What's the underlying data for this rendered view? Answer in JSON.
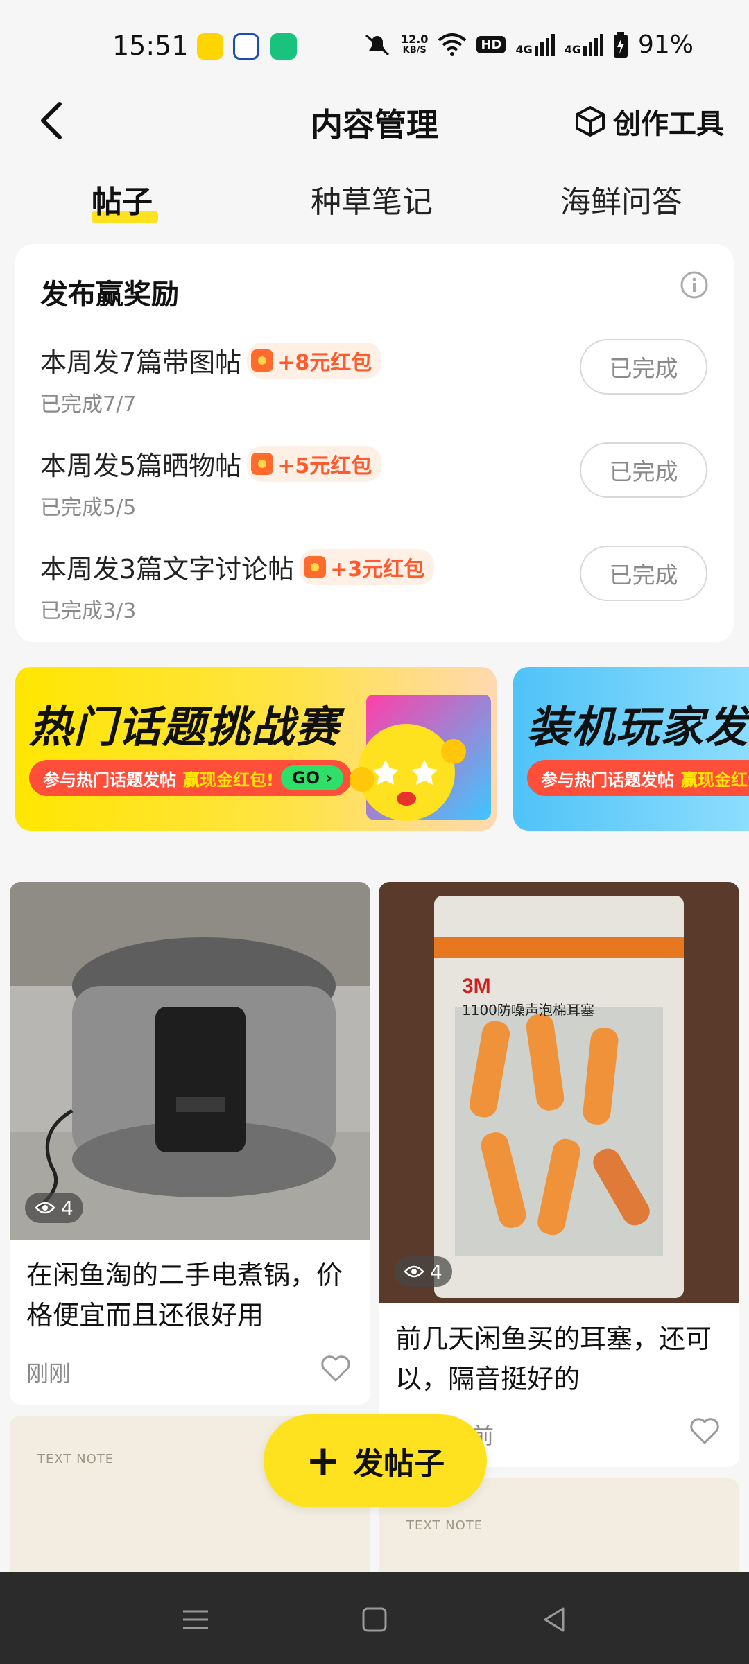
{
  "status_bar": {
    "time": "15:51",
    "net_speed_top": "12.0",
    "net_speed_unit": "KB/S",
    "hd_label": "HD",
    "signal_1": "4G",
    "signal_2": "4G",
    "battery": "91%"
  },
  "header": {
    "title": "内容管理",
    "tools_label": "创作工具"
  },
  "tabs": [
    {
      "label": "帖子",
      "active": true
    },
    {
      "label": "种草笔记",
      "active": false
    },
    {
      "label": "海鲜问答",
      "active": false
    }
  ],
  "reward_card": {
    "title": "发布赢奖励",
    "tasks": [
      {
        "title": "本周发7篇带图帖",
        "reward": "+8元红包",
        "progress": "已完成7/7",
        "button": "已完成"
      },
      {
        "title": "本周发5篇晒物帖",
        "reward": "+5元红包",
        "progress": "已完成5/5",
        "button": "已完成"
      },
      {
        "title": "本周发3篇文字讨论帖",
        "reward": "+3元红包",
        "progress": "已完成3/3",
        "button": "已完成"
      }
    ]
  },
  "banners": [
    {
      "title": "热门话题挑战赛",
      "sub_text": "参与热门话题发帖",
      "highlight": "赢现金红包!",
      "go": "GO ›"
    },
    {
      "title": "装机玩家发帖",
      "sub_text": "参与热门话题发帖",
      "highlight": "赢现金红包!"
    }
  ],
  "posts": [
    {
      "views": "4",
      "title": "在闲鱼淘的二手电煮锅，价格便宜而且还很好用",
      "time": "刚刚"
    },
    {
      "views": "4",
      "title": "前几天闲鱼买的耳塞，还可以，隔音挺好的",
      "time": "前",
      "package_brand": "3M",
      "package_text": "1100防噪声泡棉耳塞"
    }
  ],
  "text_notes": [
    {
      "label": "TEXT NOTE"
    },
    {
      "label": "TEXT NOTE"
    }
  ],
  "fab": {
    "label": "发帖子"
  },
  "colors": {
    "accent_yellow": "#FFE21F",
    "reward_red": "#FF5A2E",
    "background": "#F6F6F6",
    "nav_bar": "#2B2B2B"
  }
}
